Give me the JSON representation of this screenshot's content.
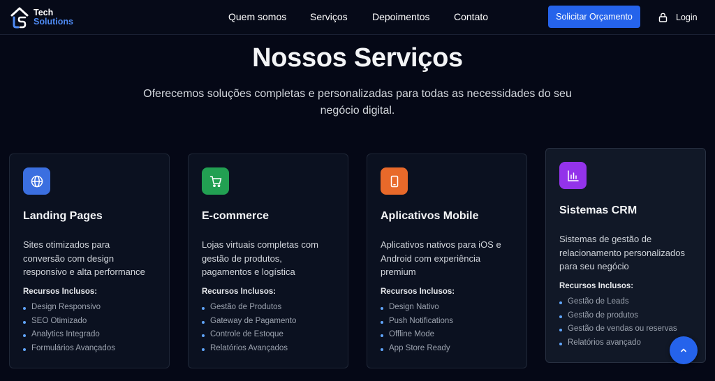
{
  "brand": {
    "line1": "Tech",
    "line2": "Solutions"
  },
  "nav": {
    "links": [
      "Quem somos",
      "Serviços",
      "Depoimentos",
      "Contato"
    ]
  },
  "header": {
    "cta_label": "Solicitar Orçamento",
    "login_label": "Login"
  },
  "hero": {
    "title": "Nossos Serviços",
    "subtitle_line1": "Oferecemos soluções completas e personalizadas para todas as necessidades do seu",
    "subtitle_line2": "negócio digital."
  },
  "colors": {
    "accent": "#2563eb",
    "background": "#050816",
    "bullet": "#60a5fa"
  },
  "services": [
    {
      "icon": "globe-icon",
      "icon_color": "#3b6fe0",
      "title": "Landing Pages",
      "desc_lines": [
        "Sites otimizados para",
        "conversão com design",
        "responsivo e alta performance"
      ],
      "features_title": "Recursos Inclusos:",
      "features": [
        "Design Responsivo",
        "SEO Otimizado",
        "Analytics Integrado",
        "Formulários Avançados"
      ]
    },
    {
      "icon": "cart-icon",
      "icon_color": "#22a052",
      "title": "E-commerce",
      "desc_lines": [
        "Lojas virtuais completas com",
        "gestão de produtos,",
        "pagamentos e logística"
      ],
      "features_title": "Recursos Inclusos:",
      "features": [
        "Gestão de Produtos",
        "Gateway de Pagamento",
        "Controle de Estoque",
        "Relatórios Avançados"
      ]
    },
    {
      "icon": "smartphone-icon",
      "icon_color": "#e8692a",
      "title": "Aplicativos Mobile",
      "desc_lines": [
        "Aplicativos nativos para iOS e",
        "Android com experiência",
        "premium"
      ],
      "features_title": "Recursos Inclusos:",
      "features": [
        "Design Nativo",
        "Push Notifications",
        "Offline Mode",
        "App Store Ready"
      ]
    },
    {
      "icon": "bar-chart-icon",
      "icon_color": "#9333ea",
      "title": "Sistemas CRM",
      "desc_lines": [
        "Sistemas de gestão de",
        "relacionamento personalizados",
        "para seu negócio"
      ],
      "features_title": "Recursos Inclusos:",
      "features": [
        "Gestão de Leads",
        "Gestão de produtos",
        "Gestão de vendas ou reservas",
        "Relatórios avançado"
      ]
    }
  ],
  "scroll_top_icon": "chevron-up-icon"
}
